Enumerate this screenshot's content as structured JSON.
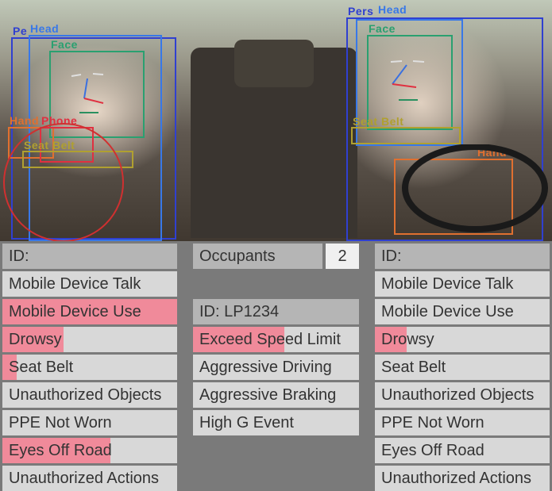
{
  "detections": {
    "left_person": {
      "label": "Pe",
      "color": "#3040d0"
    },
    "left_head": {
      "label": "Head",
      "color": "#3060e0"
    },
    "left_face": {
      "label": "Face",
      "color": "#2aa070"
    },
    "left_hand": {
      "label": "Hand",
      "color": "#e07030"
    },
    "left_phone": {
      "label": "Phone",
      "color": "#e03040"
    },
    "left_seatbelt": {
      "label": "Seat Belt",
      "color": "#b0a030"
    },
    "left_ellipse": {
      "color": "#d03030"
    },
    "right_person": {
      "label": "Pers",
      "color": "#3040d0"
    },
    "right_head": {
      "label": "Head",
      "color": "#3060e0"
    },
    "right_face": {
      "label": "Face",
      "color": "#2aa070"
    },
    "right_hand": {
      "label": "Hand",
      "color": "#e07030"
    },
    "right_seatbelt": {
      "label": "Seat Belt",
      "color": "#b0a030"
    }
  },
  "occupants": {
    "label": "Occupants",
    "count": "2"
  },
  "vehicle": {
    "id_label": "ID: LP1234",
    "rows": [
      {
        "label": "Exceed Speed Limit",
        "alert": 0.55
      },
      {
        "label": "Aggressive Driving",
        "alert": 0
      },
      {
        "label": "Aggressive Braking",
        "alert": 0
      },
      {
        "label": "High G Event",
        "alert": 0
      }
    ]
  },
  "left": {
    "id_label": "ID:",
    "rows": [
      {
        "label": "Mobile Device Talk",
        "alert": 0
      },
      {
        "label": "Mobile Device Use",
        "alert": 1.0
      },
      {
        "label": "Drowsy",
        "alert": 0.35
      },
      {
        "label": "Seat Belt",
        "alert": 0.08
      },
      {
        "label": "Unauthorized Objects",
        "alert": 0
      },
      {
        "label": "PPE Not Worn",
        "alert": 0
      },
      {
        "label": "Eyes Off Road",
        "alert": 0.62
      },
      {
        "label": "Unauthorized Actions",
        "alert": 0
      }
    ]
  },
  "right": {
    "id_label": "ID:",
    "rows": [
      {
        "label": "Mobile Device Talk",
        "alert": 0
      },
      {
        "label": "Mobile Device Use",
        "alert": 0
      },
      {
        "label": "Drowsy",
        "alert": 0.18
      },
      {
        "label": "Seat Belt",
        "alert": 0
      },
      {
        "label": "Unauthorized Objects",
        "alert": 0
      },
      {
        "label": "PPE Not Worn",
        "alert": 0
      },
      {
        "label": "Eyes Off Road",
        "alert": 0
      },
      {
        "label": "Unauthorized Actions",
        "alert": 0
      }
    ]
  }
}
